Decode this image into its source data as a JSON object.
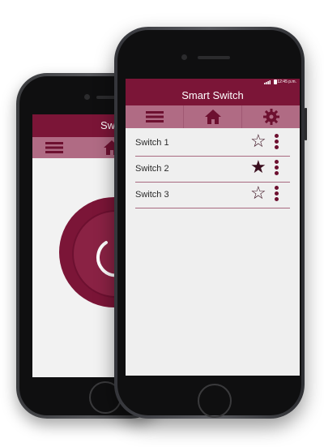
{
  "status_bar": {
    "time": "12:45 p.m."
  },
  "app": {
    "title": "Smart Switch"
  },
  "back_screen": {
    "title": "Switc"
  },
  "toolbar": {
    "items": [
      {
        "icon": "menu-icon"
      },
      {
        "icon": "home-icon"
      },
      {
        "icon": "gear-icon"
      }
    ]
  },
  "switches": [
    {
      "label": "Switch 1",
      "favorite": false
    },
    {
      "label": "Switch 2",
      "favorite": true
    },
    {
      "label": "Switch 3",
      "favorite": false
    }
  ],
  "colors": {
    "primary": "#7b1537",
    "toolbar": "#b06b84",
    "divider": "#a86a80",
    "background": "#efefef"
  }
}
